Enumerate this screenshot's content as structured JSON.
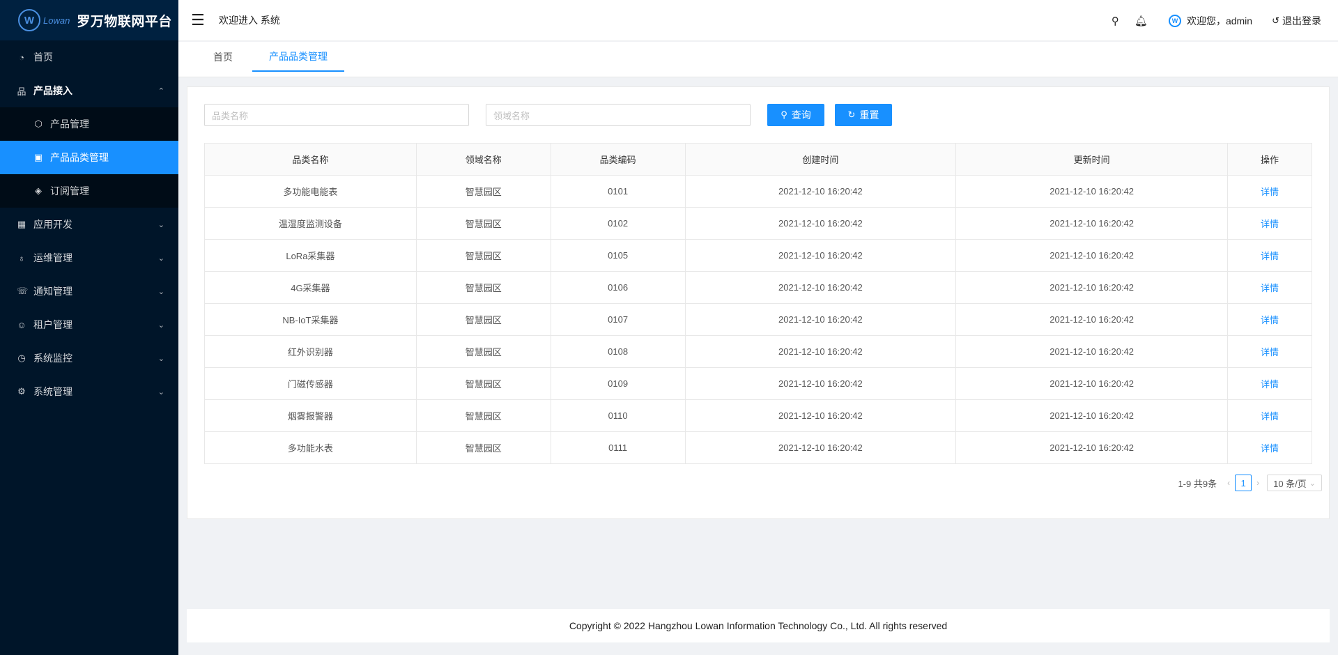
{
  "brand": {
    "mark": "W",
    "sub": "Lowan",
    "title": "罗万物联网平台"
  },
  "sidebar": {
    "items": [
      {
        "label": "首页",
        "icon": "dashboard-icon"
      },
      {
        "label": "产品接入",
        "icon": "cluster-icon",
        "open": true,
        "children": [
          {
            "label": "产品管理",
            "icon": "product-icon"
          },
          {
            "label": "产品品类管理",
            "icon": "category-icon",
            "active": true
          },
          {
            "label": "订阅管理",
            "icon": "tag-icon"
          }
        ]
      },
      {
        "label": "应用开发",
        "icon": "appstore-icon"
      },
      {
        "label": "运维管理",
        "icon": "bulb-icon"
      },
      {
        "label": "通知管理",
        "icon": "phone-icon"
      },
      {
        "label": "租户管理",
        "icon": "team-icon"
      },
      {
        "label": "系统监控",
        "icon": "monitor-icon"
      },
      {
        "label": "系统管理",
        "icon": "setting-icon"
      }
    ]
  },
  "header": {
    "welcome": "欢迎进入 系统",
    "user_greeting": "欢迎您，admin",
    "logout": "退出登录"
  },
  "tabs": [
    {
      "label": "首页"
    },
    {
      "label": "产品品类管理",
      "active": true
    }
  ],
  "filters": {
    "category_placeholder": "品类名称",
    "domain_placeholder": "领域名称",
    "query_label": "查询",
    "reset_label": "重置"
  },
  "table": {
    "columns": [
      "品类名称",
      "领域名称",
      "品类编码",
      "创建时间",
      "更新时间",
      "操作"
    ],
    "rows": [
      [
        "多功能电能表",
        "智慧园区",
        "0101",
        "2021-12-10 16:20:42",
        "2021-12-10 16:20:42",
        "详情"
      ],
      [
        "温湿度监测设备",
        "智慧园区",
        "0102",
        "2021-12-10 16:20:42",
        "2021-12-10 16:20:42",
        "详情"
      ],
      [
        "LoRa采集器",
        "智慧园区",
        "0105",
        "2021-12-10 16:20:42",
        "2021-12-10 16:20:42",
        "详情"
      ],
      [
        "4G采集器",
        "智慧园区",
        "0106",
        "2021-12-10 16:20:42",
        "2021-12-10 16:20:42",
        "详情"
      ],
      [
        "NB-IoT采集器",
        "智慧园区",
        "0107",
        "2021-12-10 16:20:42",
        "2021-12-10 16:20:42",
        "详情"
      ],
      [
        "红外识别器",
        "智慧园区",
        "0108",
        "2021-12-10 16:20:42",
        "2021-12-10 16:20:42",
        "详情"
      ],
      [
        "门磁传感器",
        "智慧园区",
        "0109",
        "2021-12-10 16:20:42",
        "2021-12-10 16:20:42",
        "详情"
      ],
      [
        "烟雾报警器",
        "智慧园区",
        "0110",
        "2021-12-10 16:20:42",
        "2021-12-10 16:20:42",
        "详情"
      ],
      [
        "多功能水表",
        "智慧园区",
        "0111",
        "2021-12-10 16:20:42",
        "2021-12-10 16:20:42",
        "详情"
      ]
    ]
  },
  "pagination": {
    "summary": "1-9 共9条",
    "current_page": "1",
    "page_size": "10 条/页"
  },
  "footer": {
    "copyright": "Copyright © 2022 Hangzhou Lowan Information Technology Co., Ltd. All rights reserved"
  },
  "colors": {
    "primary": "#1890ff",
    "sidebar_bg": "#001529",
    "submenu_bg": "#000c17"
  }
}
